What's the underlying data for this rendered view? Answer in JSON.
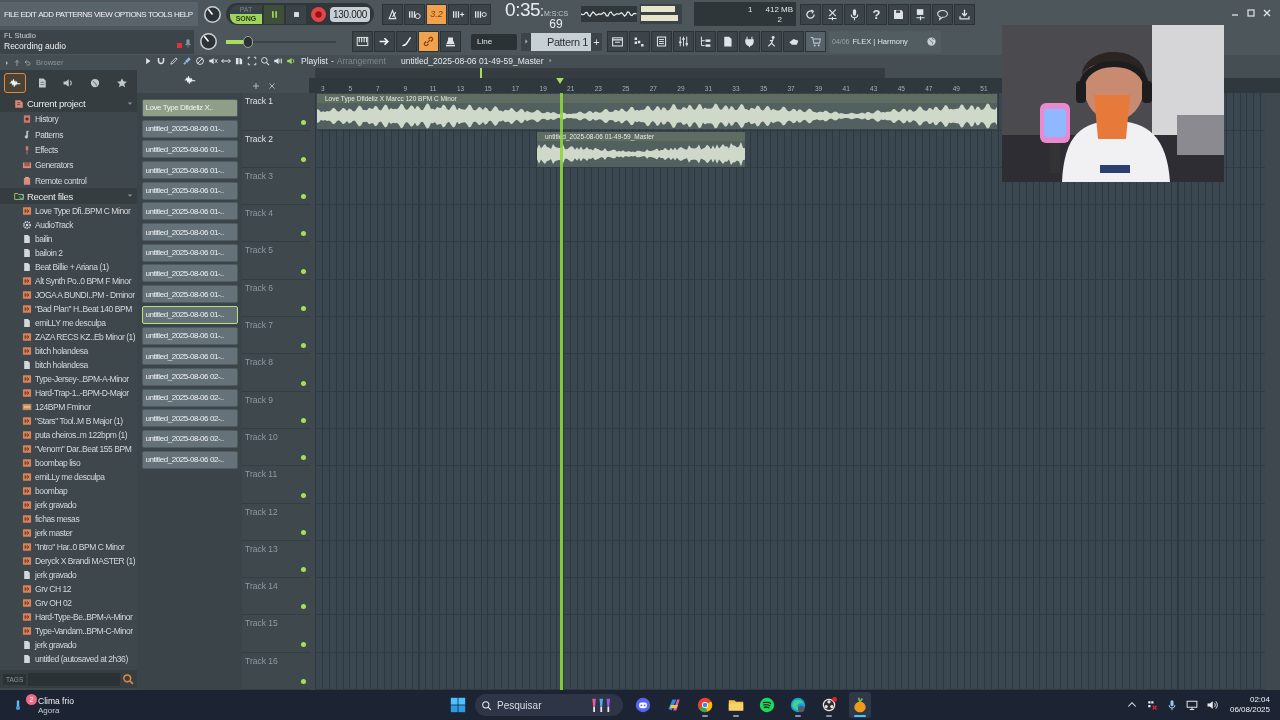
{
  "menu": [
    "FILE",
    "EDIT",
    "ADD",
    "PATTERNS",
    "VIEW",
    "OPTIONS",
    "TOOLS",
    "HELP"
  ],
  "hint_panel": {
    "title": "FL Studio",
    "status": "Recording audio",
    "recording": true
  },
  "transport": {
    "pattern_label": "PAT",
    "song_label": "SONG",
    "song_mode": true,
    "tempo": "130.000"
  },
  "time": {
    "value": "0:35",
    "separator": ":",
    "centis": "69",
    "format": "M:S:CS"
  },
  "perf": {
    "polyphony": "1",
    "memory": "412 MB",
    "cpu": "2"
  },
  "record_buttons": [
    {
      "on": false
    },
    {
      "on": false
    },
    {
      "label": "3.2",
      "on": true
    },
    {
      "on": false
    },
    {
      "on": false
    }
  ],
  "help_glyph": "?",
  "master_volume": {
    "level": 0.2
  },
  "tool_buttons": [
    {
      "on": false
    },
    {
      "on": false
    },
    {
      "on": false
    },
    {
      "on": true
    },
    {
      "on": false
    }
  ],
  "snap": "Line",
  "pattern": {
    "name": "Pattern 1",
    "add": "+"
  },
  "news": {
    "counter": "04/06",
    "text": "FLEX | Harmony"
  },
  "browser": {
    "title": "Browser",
    "tabs": [
      {
        "selected": true
      },
      {
        "selected": false
      },
      {
        "selected": false
      },
      {
        "selected": false
      },
      {
        "selected": false
      }
    ],
    "tags_label": "TAGS",
    "tree": [
      {
        "name": "Current project",
        "kind": "project-folder",
        "expanded": true,
        "children": [
          {
            "name": "History",
            "kind": "history"
          },
          {
            "name": "Patterns",
            "kind": "note"
          },
          {
            "name": "Effects",
            "kind": "effect"
          },
          {
            "name": "Generators",
            "kind": "keys"
          },
          {
            "name": "Remote control",
            "kind": "remote"
          }
        ]
      },
      {
        "name": "Recent files",
        "kind": "recent-folder",
        "expanded": true,
        "children": [
          {
            "name": "Love Type Dfi..BPM C Minor",
            "kind": "project"
          },
          {
            "name": "AudioTrack",
            "kind": "gear"
          },
          {
            "name": "bailin",
            "kind": "file"
          },
          {
            "name": "bailoin 2",
            "kind": "file"
          },
          {
            "name": "Beat Billie + Ariana (1)",
            "kind": "file"
          },
          {
            "name": "Alt Synth Po..0 BPM F Minor",
            "kind": "project"
          },
          {
            "name": "JOGA A BUNDI..PM  - Dminor",
            "kind": "project"
          },
          {
            "name": "\"Bad Plan\" H..Beat 140 BPM",
            "kind": "project"
          },
          {
            "name": "emiLLY me desculpa",
            "kind": "file"
          },
          {
            "name": "ZAZA RECS KZ..Eb Minor (1)",
            "kind": "project"
          },
          {
            "name": "bitch holandesa",
            "kind": "project"
          },
          {
            "name": "bitch holandesa",
            "kind": "file"
          },
          {
            "name": "Type-Jersey-..BPM-A-Minor",
            "kind": "project"
          },
          {
            "name": "Hard-Trap-1..-BPM-D-Major",
            "kind": "project"
          },
          {
            "name": "124BPM Fminor",
            "kind": "mp3"
          },
          {
            "name": "\"Stars\" Tool..M B Major (1)",
            "kind": "project"
          },
          {
            "name": "puta cheiros..m 122bpm (1)",
            "kind": "project"
          },
          {
            "name": "\"Venom\" Dar..Beat 155 BPM",
            "kind": "project"
          },
          {
            "name": "boombap liso",
            "kind": "project"
          },
          {
            "name": "emiLLy me desculpa",
            "kind": "project"
          },
          {
            "name": "boombap",
            "kind": "project"
          },
          {
            "name": "jerk gravado",
            "kind": "project"
          },
          {
            "name": "fichas mesas",
            "kind": "project"
          },
          {
            "name": "jerk master",
            "kind": "project"
          },
          {
            "name": "\"Intro\" Har..0 BPM C Minor",
            "kind": "project"
          },
          {
            "name": "Deryck X Brandi MASTER (1)",
            "kind": "project"
          },
          {
            "name": "jerk gravado",
            "kind": "file"
          },
          {
            "name": "Grv CH 12",
            "kind": "project"
          },
          {
            "name": "Grv OH 02",
            "kind": "project"
          },
          {
            "name": "Hard-Type-Be..BPM-A-Minor",
            "kind": "project"
          },
          {
            "name": "Type-Vandam..BPM-C-Minor",
            "kind": "project"
          },
          {
            "name": "jerk gravado",
            "kind": "file"
          },
          {
            "name": "untitled (autosaved at 2h36)",
            "kind": "file"
          }
        ]
      }
    ]
  },
  "clip_list": [
    {
      "name": "Love Type Dfideliz X..",
      "current": true,
      "selected": false
    },
    {
      "name": "untitled_2025-08-06 01-..",
      "current": false,
      "selected": false
    },
    {
      "name": "untitled_2025-08-06 01-..",
      "current": false,
      "selected": false
    },
    {
      "name": "untitled_2025-08-06 01-..",
      "current": false,
      "selected": false
    },
    {
      "name": "untitled_2025-08-06 01-..",
      "current": false,
      "selected": false
    },
    {
      "name": "untitled_2025-08-06 01-..",
      "current": false,
      "selected": false
    },
    {
      "name": "untitled_2025-08-06 01-..",
      "current": false,
      "selected": false
    },
    {
      "name": "untitled_2025-08-06 01-..",
      "current": false,
      "selected": false
    },
    {
      "name": "untitled_2025-08-06 01-..",
      "current": false,
      "selected": false
    },
    {
      "name": "untitled_2025-08-06 01-..",
      "current": false,
      "selected": false
    },
    {
      "name": "untitled_2025-08-06 01-..",
      "current": false,
      "selected": true
    },
    {
      "name": "untitled_2025-08-06 01-..",
      "current": false,
      "selected": false
    },
    {
      "name": "untitled_2025-08-06 01-..",
      "current": false,
      "selected": false
    },
    {
      "name": "untitled_2025-08-06 02-..",
      "current": false,
      "selected": false
    },
    {
      "name": "untitled_2025-08-06 02-..",
      "current": false,
      "selected": false
    },
    {
      "name": "untitled_2025-08-06 02-..",
      "current": false,
      "selected": false
    },
    {
      "name": "untitled_2025-08-06 02-..",
      "current": false,
      "selected": false
    },
    {
      "name": "untitled_2025-08-06 02-..",
      "current": false,
      "selected": false
    }
  ],
  "playlist": {
    "title": "Playlist",
    "separator": "-",
    "subtitle": "Arrangement",
    "project_clip": "untitled_2025-08-06 01-49-59_Master",
    "ruler": [
      "3",
      "5",
      "7",
      "9",
      "11",
      "13",
      "15",
      "17",
      "19",
      "21",
      "23",
      "25",
      "27",
      "29",
      "31",
      "33",
      "35",
      "37",
      "39",
      "41",
      "43",
      "45",
      "47",
      "49",
      "51"
    ],
    "tracks": [
      {
        "name": "Track 1",
        "active": true,
        "clip": {
          "name": "Love Type Dfideliz X Marcc 120 BPM C Minor"
        }
      },
      {
        "name": "Track 2",
        "active": true,
        "clip": {
          "name": "untitled_2025-08-06 01-49-59_Master"
        }
      },
      {
        "name": "Track 3",
        "active": false
      },
      {
        "name": "Track 4",
        "active": false
      },
      {
        "name": "Track 5",
        "active": false
      },
      {
        "name": "Track 6",
        "active": false
      },
      {
        "name": "Track 7",
        "active": false
      },
      {
        "name": "Track 8",
        "active": false
      },
      {
        "name": "Track 9",
        "active": false
      },
      {
        "name": "Track 10",
        "active": false
      },
      {
        "name": "Track 11",
        "active": false
      },
      {
        "name": "Track 12",
        "active": false
      },
      {
        "name": "Track 13",
        "active": false
      },
      {
        "name": "Track 14",
        "active": false
      },
      {
        "name": "Track 15",
        "active": false
      },
      {
        "name": "Track 16",
        "active": false
      }
    ]
  },
  "taskbar": {
    "weather": {
      "text": "Clima frio",
      "sub": "Agora",
      "badge": "2"
    },
    "search_placeholder": "Pesquisar",
    "apps": [
      {
        "running": false,
        "selected": false
      },
      {
        "running": false,
        "selected": false
      },
      {
        "running": true,
        "selected": false
      },
      {
        "running": true,
        "selected": false
      },
      {
        "running": false,
        "selected": false
      },
      {
        "running": true,
        "selected": false
      },
      {
        "running": true,
        "selected": false
      },
      {
        "running": true,
        "selected": true
      }
    ],
    "time": "02:04",
    "date": "06/08/2025"
  }
}
